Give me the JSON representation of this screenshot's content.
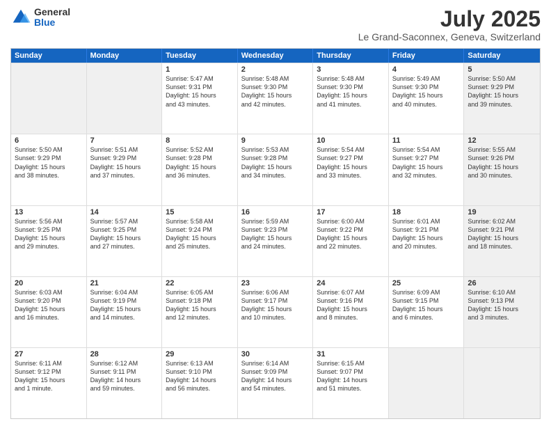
{
  "logo": {
    "general": "General",
    "blue": "Blue"
  },
  "title": "July 2025",
  "subtitle": "Le Grand-Saconnex, Geneva, Switzerland",
  "weekdays": [
    "Sunday",
    "Monday",
    "Tuesday",
    "Wednesday",
    "Thursday",
    "Friday",
    "Saturday"
  ],
  "rows": [
    [
      {
        "day": "",
        "info": "",
        "shaded": true
      },
      {
        "day": "",
        "info": "",
        "shaded": true
      },
      {
        "day": "1",
        "info": "Sunrise: 5:47 AM\nSunset: 9:31 PM\nDaylight: 15 hours\nand 43 minutes."
      },
      {
        "day": "2",
        "info": "Sunrise: 5:48 AM\nSunset: 9:30 PM\nDaylight: 15 hours\nand 42 minutes."
      },
      {
        "day": "3",
        "info": "Sunrise: 5:48 AM\nSunset: 9:30 PM\nDaylight: 15 hours\nand 41 minutes."
      },
      {
        "day": "4",
        "info": "Sunrise: 5:49 AM\nSunset: 9:30 PM\nDaylight: 15 hours\nand 40 minutes."
      },
      {
        "day": "5",
        "info": "Sunrise: 5:50 AM\nSunset: 9:29 PM\nDaylight: 15 hours\nand 39 minutes.",
        "shaded": true
      }
    ],
    [
      {
        "day": "6",
        "info": "Sunrise: 5:50 AM\nSunset: 9:29 PM\nDaylight: 15 hours\nand 38 minutes."
      },
      {
        "day": "7",
        "info": "Sunrise: 5:51 AM\nSunset: 9:29 PM\nDaylight: 15 hours\nand 37 minutes."
      },
      {
        "day": "8",
        "info": "Sunrise: 5:52 AM\nSunset: 9:28 PM\nDaylight: 15 hours\nand 36 minutes."
      },
      {
        "day": "9",
        "info": "Sunrise: 5:53 AM\nSunset: 9:28 PM\nDaylight: 15 hours\nand 34 minutes."
      },
      {
        "day": "10",
        "info": "Sunrise: 5:54 AM\nSunset: 9:27 PM\nDaylight: 15 hours\nand 33 minutes."
      },
      {
        "day": "11",
        "info": "Sunrise: 5:54 AM\nSunset: 9:27 PM\nDaylight: 15 hours\nand 32 minutes."
      },
      {
        "day": "12",
        "info": "Sunrise: 5:55 AM\nSunset: 9:26 PM\nDaylight: 15 hours\nand 30 minutes.",
        "shaded": true
      }
    ],
    [
      {
        "day": "13",
        "info": "Sunrise: 5:56 AM\nSunset: 9:25 PM\nDaylight: 15 hours\nand 29 minutes."
      },
      {
        "day": "14",
        "info": "Sunrise: 5:57 AM\nSunset: 9:25 PM\nDaylight: 15 hours\nand 27 minutes."
      },
      {
        "day": "15",
        "info": "Sunrise: 5:58 AM\nSunset: 9:24 PM\nDaylight: 15 hours\nand 25 minutes."
      },
      {
        "day": "16",
        "info": "Sunrise: 5:59 AM\nSunset: 9:23 PM\nDaylight: 15 hours\nand 24 minutes."
      },
      {
        "day": "17",
        "info": "Sunrise: 6:00 AM\nSunset: 9:22 PM\nDaylight: 15 hours\nand 22 minutes."
      },
      {
        "day": "18",
        "info": "Sunrise: 6:01 AM\nSunset: 9:21 PM\nDaylight: 15 hours\nand 20 minutes."
      },
      {
        "day": "19",
        "info": "Sunrise: 6:02 AM\nSunset: 9:21 PM\nDaylight: 15 hours\nand 18 minutes.",
        "shaded": true
      }
    ],
    [
      {
        "day": "20",
        "info": "Sunrise: 6:03 AM\nSunset: 9:20 PM\nDaylight: 15 hours\nand 16 minutes."
      },
      {
        "day": "21",
        "info": "Sunrise: 6:04 AM\nSunset: 9:19 PM\nDaylight: 15 hours\nand 14 minutes."
      },
      {
        "day": "22",
        "info": "Sunrise: 6:05 AM\nSunset: 9:18 PM\nDaylight: 15 hours\nand 12 minutes."
      },
      {
        "day": "23",
        "info": "Sunrise: 6:06 AM\nSunset: 9:17 PM\nDaylight: 15 hours\nand 10 minutes."
      },
      {
        "day": "24",
        "info": "Sunrise: 6:07 AM\nSunset: 9:16 PM\nDaylight: 15 hours\nand 8 minutes."
      },
      {
        "day": "25",
        "info": "Sunrise: 6:09 AM\nSunset: 9:15 PM\nDaylight: 15 hours\nand 6 minutes."
      },
      {
        "day": "26",
        "info": "Sunrise: 6:10 AM\nSunset: 9:13 PM\nDaylight: 15 hours\nand 3 minutes.",
        "shaded": true
      }
    ],
    [
      {
        "day": "27",
        "info": "Sunrise: 6:11 AM\nSunset: 9:12 PM\nDaylight: 15 hours\nand 1 minute."
      },
      {
        "day": "28",
        "info": "Sunrise: 6:12 AM\nSunset: 9:11 PM\nDaylight: 14 hours\nand 59 minutes."
      },
      {
        "day": "29",
        "info": "Sunrise: 6:13 AM\nSunset: 9:10 PM\nDaylight: 14 hours\nand 56 minutes."
      },
      {
        "day": "30",
        "info": "Sunrise: 6:14 AM\nSunset: 9:09 PM\nDaylight: 14 hours\nand 54 minutes."
      },
      {
        "day": "31",
        "info": "Sunrise: 6:15 AM\nSunset: 9:07 PM\nDaylight: 14 hours\nand 51 minutes."
      },
      {
        "day": "",
        "info": "",
        "shaded": true
      },
      {
        "day": "",
        "info": "",
        "shaded": true
      }
    ]
  ]
}
